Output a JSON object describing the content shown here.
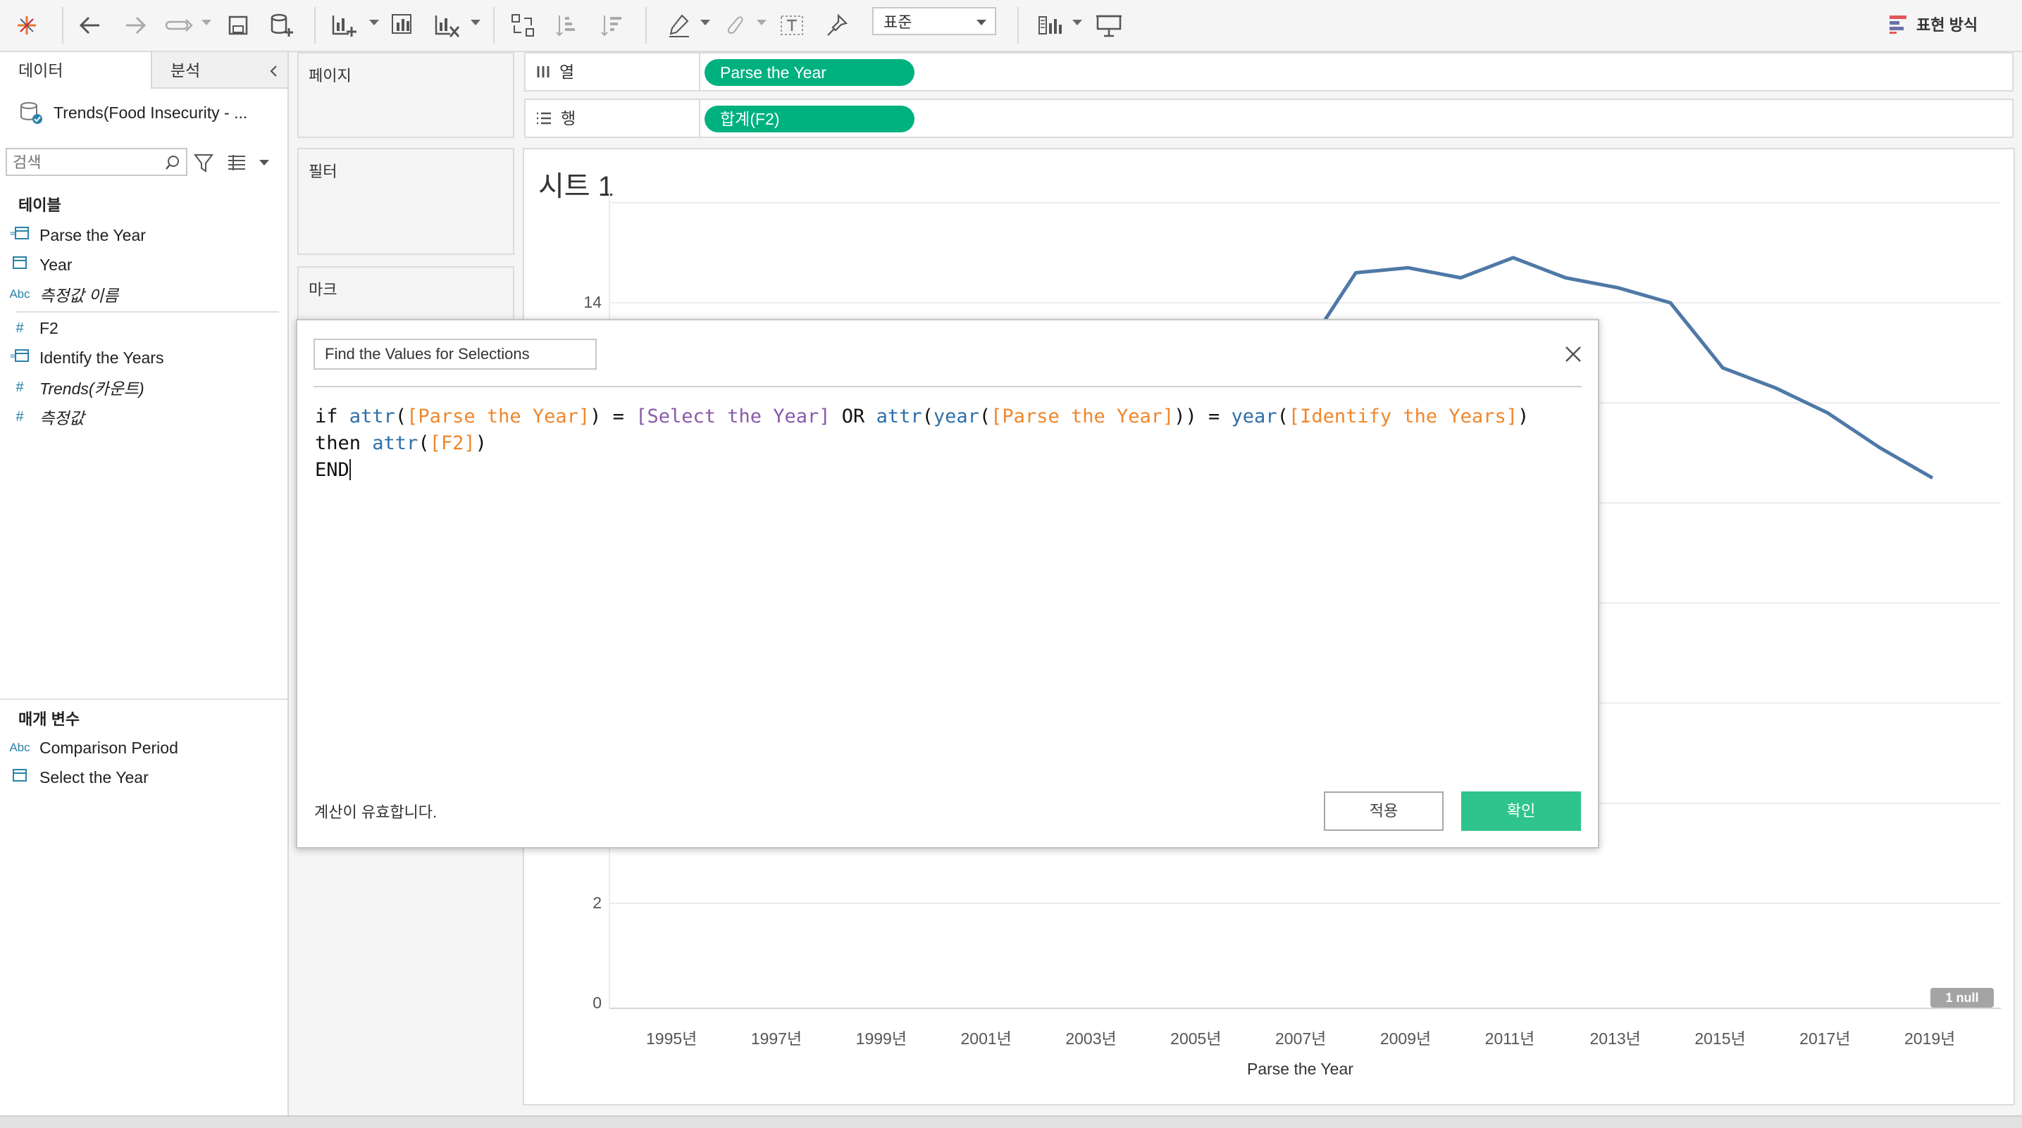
{
  "toolbar": {
    "fit_value": "표준",
    "show_me_label": "표현 방식",
    "icons": [
      "tableau-logo-icon",
      "back-icon",
      "forward-icon",
      "redo-icon",
      "save-icon",
      "new-datasource-icon",
      "new-worksheet-icon",
      "duplicate-icon",
      "clear-sheet-icon",
      "swap-icon",
      "sort-asc-icon",
      "sort-desc-icon",
      "highlight-icon",
      "group-icon",
      "label-icon",
      "pin-icon",
      "show-cards-icon",
      "presentation-icon",
      "show-me-icon"
    ]
  },
  "left_panel": {
    "tabs": [
      {
        "label": "데이터"
      },
      {
        "label": "분석"
      }
    ],
    "datasource": "Trends(Food Insecurity - ...",
    "search_placeholder": "검색",
    "tables_title": "테이블",
    "fields": [
      {
        "label": "Parse the Year",
        "icon": "date-calc-icon"
      },
      {
        "label": "Year",
        "icon": "date-icon"
      },
      {
        "label": "측정값 이름",
        "icon": "abc-icon"
      },
      {
        "label": "F2",
        "icon": "number-icon"
      },
      {
        "label": "Identify the Years",
        "icon": "date-calc-icon"
      },
      {
        "label": "Trends(카운트)",
        "icon": "number-icon"
      },
      {
        "label": "측정값",
        "icon": "number-icon"
      }
    ],
    "params_title": "매개 변수",
    "params": [
      {
        "label": "Comparison Period",
        "icon": "abc-icon"
      },
      {
        "label": "Select the Year",
        "icon": "date-icon"
      }
    ]
  },
  "cards": {
    "pages": "페이지",
    "filters": "필터",
    "marks": "마크"
  },
  "shelves": {
    "columns": {
      "label": "열",
      "pill": "Parse the Year"
    },
    "rows": {
      "label": "행",
      "pill": "합계(F2)"
    }
  },
  "sheet": {
    "title": "시트 1"
  },
  "chart_data": {
    "type": "line",
    "xlabel": "Parse the Year",
    "ylabel": "",
    "x_ticks": [
      "1995년",
      "1997년",
      "1999년",
      "2001년",
      "2003년",
      "2005년",
      "2007년",
      "2009년",
      "2011년",
      "2013년",
      "2015년",
      "2017년",
      "2019년"
    ],
    "y_ticks": [
      0,
      2,
      14
    ],
    "null_badge": "1 null",
    "series": [
      {
        "color": "#4e79a7",
        "x": [
          2007,
          2008,
          2009,
          2010,
          2011,
          2012,
          2013,
          2014,
          2015,
          2016,
          2017,
          2018,
          2019
        ],
        "y": [
          13.0,
          14.6,
          14.7,
          14.5,
          14.9,
          14.5,
          14.3,
          14.0,
          12.7,
          12.3,
          11.8,
          11.1,
          10.5
        ]
      }
    ],
    "xlim": [
      1994,
      2020
    ],
    "ylim": [
      0,
      16
    ]
  },
  "dialog": {
    "calc_name": "Find the Values for Selections",
    "formula_lines": [
      [
        {
          "t": "if ",
          "c": "kw"
        },
        {
          "t": "attr",
          "c": "fn"
        },
        {
          "t": "(",
          "c": "kw"
        },
        {
          "t": "[Parse the Year]",
          "c": "fld"
        },
        {
          "t": ") = ",
          "c": "kw"
        },
        {
          "t": "[Select the Year]",
          "c": "prm"
        },
        {
          "t": " OR ",
          "c": "kw"
        },
        {
          "t": "attr",
          "c": "fn"
        },
        {
          "t": "(",
          "c": "kw"
        },
        {
          "t": "year",
          "c": "fn"
        },
        {
          "t": "(",
          "c": "kw"
        },
        {
          "t": "[Parse the Year]",
          "c": "fld"
        },
        {
          "t": ")) = ",
          "c": "kw"
        },
        {
          "t": "year",
          "c": "fn"
        },
        {
          "t": "(",
          "c": "kw"
        },
        {
          "t": "[Identify the Years]",
          "c": "fld"
        },
        {
          "t": ")",
          "c": "kw"
        }
      ],
      [
        {
          "t": "then ",
          "c": "kw"
        },
        {
          "t": "attr",
          "c": "fn"
        },
        {
          "t": "(",
          "c": "kw"
        },
        {
          "t": "[F2]",
          "c": "fld"
        },
        {
          "t": ")",
          "c": "kw"
        }
      ],
      [
        {
          "t": "END",
          "c": "kw"
        }
      ]
    ],
    "status": "계산이 유효합니다.",
    "apply_label": "적용",
    "ok_label": "확인"
  }
}
